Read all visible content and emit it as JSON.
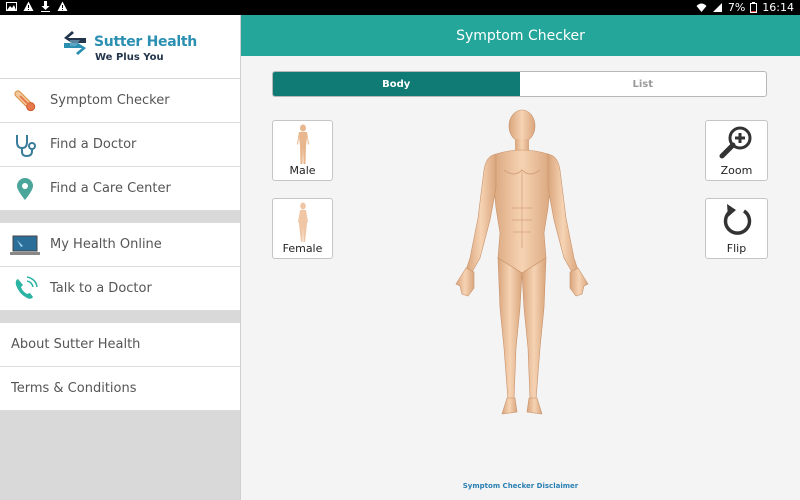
{
  "status_bar": {
    "battery": "7%",
    "time": "16:14",
    "icons": [
      "image-icon",
      "warning-icon",
      "download-icon",
      "warning-icon",
      "wifi-icon",
      "signal-icon",
      "battery-icon"
    ]
  },
  "brand": {
    "name": "Sutter Health",
    "tagline": "We Plus You",
    "color": "#2a8fb1"
  },
  "sidebar": {
    "group1": [
      {
        "label": "Symptom Checker",
        "icon": "thermometer-icon"
      },
      {
        "label": "Find a Doctor",
        "icon": "stethoscope-icon"
      },
      {
        "label": "Find a Care Center",
        "icon": "location-pin-icon"
      }
    ],
    "group2": [
      {
        "label": "My Health Online",
        "icon": "laptop-icon"
      },
      {
        "label": "Talk to a Doctor",
        "icon": "phone-icon"
      }
    ],
    "group3": [
      {
        "label": "About Sutter Health"
      },
      {
        "label": "Terms & Conditions"
      }
    ]
  },
  "main": {
    "title": "Symptom Checker",
    "header_color": "#24a69a",
    "tabs": [
      {
        "label": "Body",
        "active": true
      },
      {
        "label": "List",
        "active": false
      }
    ],
    "gender_buttons": {
      "male": "Male",
      "female": "Female"
    },
    "tools": {
      "zoom": "Zoom",
      "flip": "Flip"
    },
    "disclaimer": "Symptom Checker Disclaimer"
  }
}
